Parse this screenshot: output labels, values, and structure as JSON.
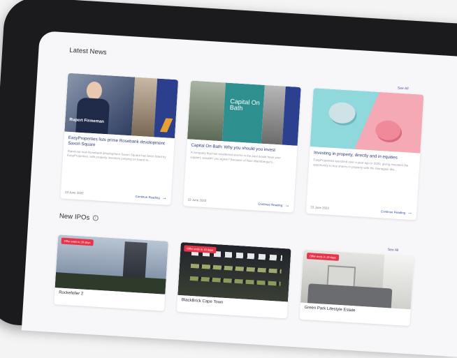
{
  "latest_news": {
    "title": "Latest News",
    "see_all": "See All",
    "cards": [
      {
        "image_caption": "Rupert Firmeman",
        "title": "EasyProperties lists prime Rosebank development Saxon Square",
        "text": "Stand-out new Rosebank development Saxon Square has been listed by EasyProperties, with property investors jumping on board to...",
        "date": "23 June 2022",
        "link": "Continue Reading"
      },
      {
        "image_caption": "Capital On Bath",
        "title": "Capital On Bath: Why you should you invest",
        "text": "A company that has weathered storms in the past would have your support, wouldn't you agree? Because of Nazi Warmberger's...",
        "date": "23 June 2022",
        "link": "Continue Reading"
      },
      {
        "title": "Investing in property, directly and in equities",
        "text": "EasyProperties launched over a year ago in 2020, giving investors the opportunity to buy shares in property with the Ownagain like...",
        "date": "23 June 2022",
        "link": "Continue Reading"
      }
    ]
  },
  "new_ipos": {
    "title": "New IPOs",
    "see_all": "See All",
    "cards": [
      {
        "badge": "Offer ends in 26 days",
        "name": "Rockefeller 2"
      },
      {
        "badge": "Offer ends in 19 days",
        "name": "BlackBrick Cape Town"
      },
      {
        "badge": "Offer ends in 19 days",
        "name": "Green Park Lifestyle Estate"
      }
    ]
  }
}
